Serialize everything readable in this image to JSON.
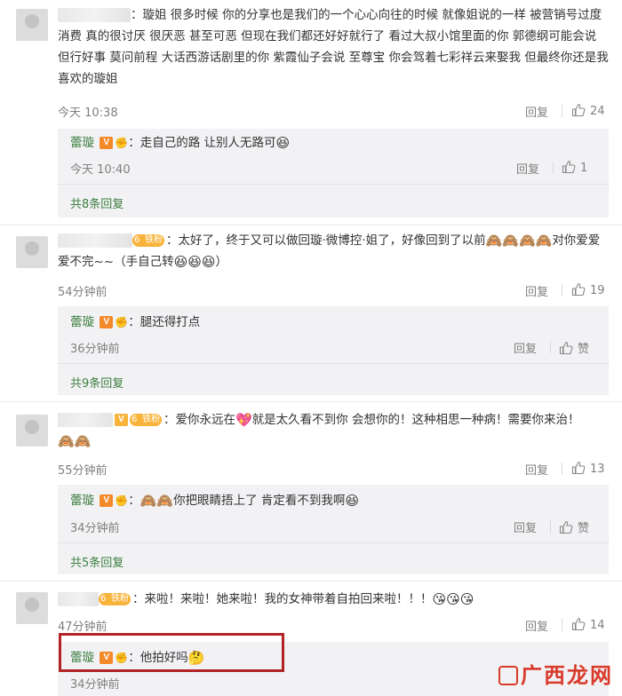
{
  "comments": [
    {
      "text": "璇姐 很多时候 你的分享也是我们的一个心心向往的时候 就像姐说的一样 被营销号过度消费 真的很讨厌 很厌恶 甚至可恶 但现在我们都还好好就行了 看过大叔小馆里面的你 郭德纲可能会说 但行好事 莫问前程 大话西游话剧里的你 紫霞仙子会说 至尊宝 你会驾着七彩祥云来娶我 但最终你还是我喜欢的璇姐",
      "time": "今天 10:38",
      "reply_label": "回复",
      "likes": "24",
      "reply": {
        "name": "蕾璇",
        "text": "走自己的路 让别人无路可",
        "time": "今天 10:40",
        "reply_label": "回复",
        "likes": "1"
      },
      "more": "共8条回复"
    },
    {
      "text": "太好了，终于又可以做回璇·微博控·姐了，好像回到了以前",
      "text2": "对你爱爱爱不完~~（手自己转",
      "text3": "）",
      "time": "54分钟前",
      "reply_label": "回复",
      "likes": "19",
      "reply": {
        "name": "蕾璇",
        "text": "腿还得打点",
        "time": "36分钟前",
        "reply_label": "回复",
        "likes": "赞"
      },
      "more": "共9条回复"
    },
    {
      "text": "爱你永远在",
      "text2": "就是太久看不到你 会想你的！这种相思一种病！需要你来治！",
      "time": "55分钟前",
      "reply_label": "回复",
      "likes": "13",
      "reply": {
        "name": "蕾璇",
        "text": "你把眼睛捂上了 肯定看不到我啊",
        "time": "34分钟前",
        "reply_label": "回复",
        "likes": "赞"
      },
      "more": "共5条回复"
    },
    {
      "text": "来啦！来啦！她来啦！我的女神带着自拍回来啦！！！",
      "time": "47分钟前",
      "reply_label": "回复",
      "likes": "14",
      "reply": {
        "name": "蕾璇",
        "text": "他拍好吗",
        "time": "34分钟前"
      }
    }
  ],
  "badges": {
    "verified": "V",
    "fan": "铁粉"
  },
  "icons": {
    "like": "thumbs-up-icon",
    "laugh": "grinning-emoji",
    "heart": "heart-emoji",
    "monkey": "see-no-evil-monkey-emoji",
    "think": "thinking-emoji",
    "fist": "fist-icon"
  },
  "colors": {
    "username": "#3c7f3e",
    "highlight": "#b22326",
    "reply_bg": "#f2f2f5"
  },
  "watermark": {
    "text": "广西龙网",
    "sub": ""
  }
}
